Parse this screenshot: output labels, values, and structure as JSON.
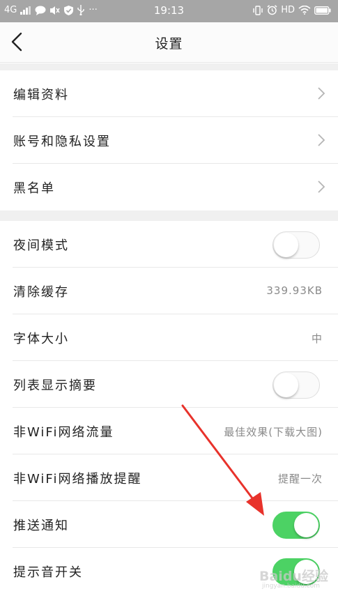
{
  "status_bar": {
    "network": "4G",
    "time": "19:13",
    "hd": "HD",
    "more": "···"
  },
  "header": {
    "title": "设置"
  },
  "group1": [
    {
      "label": "编辑资料"
    },
    {
      "label": "账号和隐私设置"
    },
    {
      "label": "黑名单"
    }
  ],
  "group2": {
    "night_mode": {
      "label": "夜间模式",
      "enabled": false
    },
    "clear_cache": {
      "label": "清除缓存",
      "value": "339.93KB"
    },
    "font_size": {
      "label": "字体大小",
      "value": "中"
    },
    "list_summary": {
      "label": "列表显示摘要",
      "enabled": false
    },
    "non_wifi_traffic": {
      "label": "非WiFi网络流量",
      "value": "最佳效果(下载大图)"
    },
    "non_wifi_play": {
      "label": "非WiFi网络播放提醒",
      "value": "提醒一次"
    },
    "push_notify": {
      "label": "推送通知",
      "enabled": true
    },
    "sound_switch": {
      "label": "提示音开关",
      "enabled": true
    }
  },
  "colors": {
    "toggle_on": "#4cd264",
    "annotation_arrow": "#e8322b",
    "status_bar": "#a6a6a6"
  },
  "watermark": {
    "text": "Baidu经验",
    "sub": "jingyan.baidu.com"
  }
}
